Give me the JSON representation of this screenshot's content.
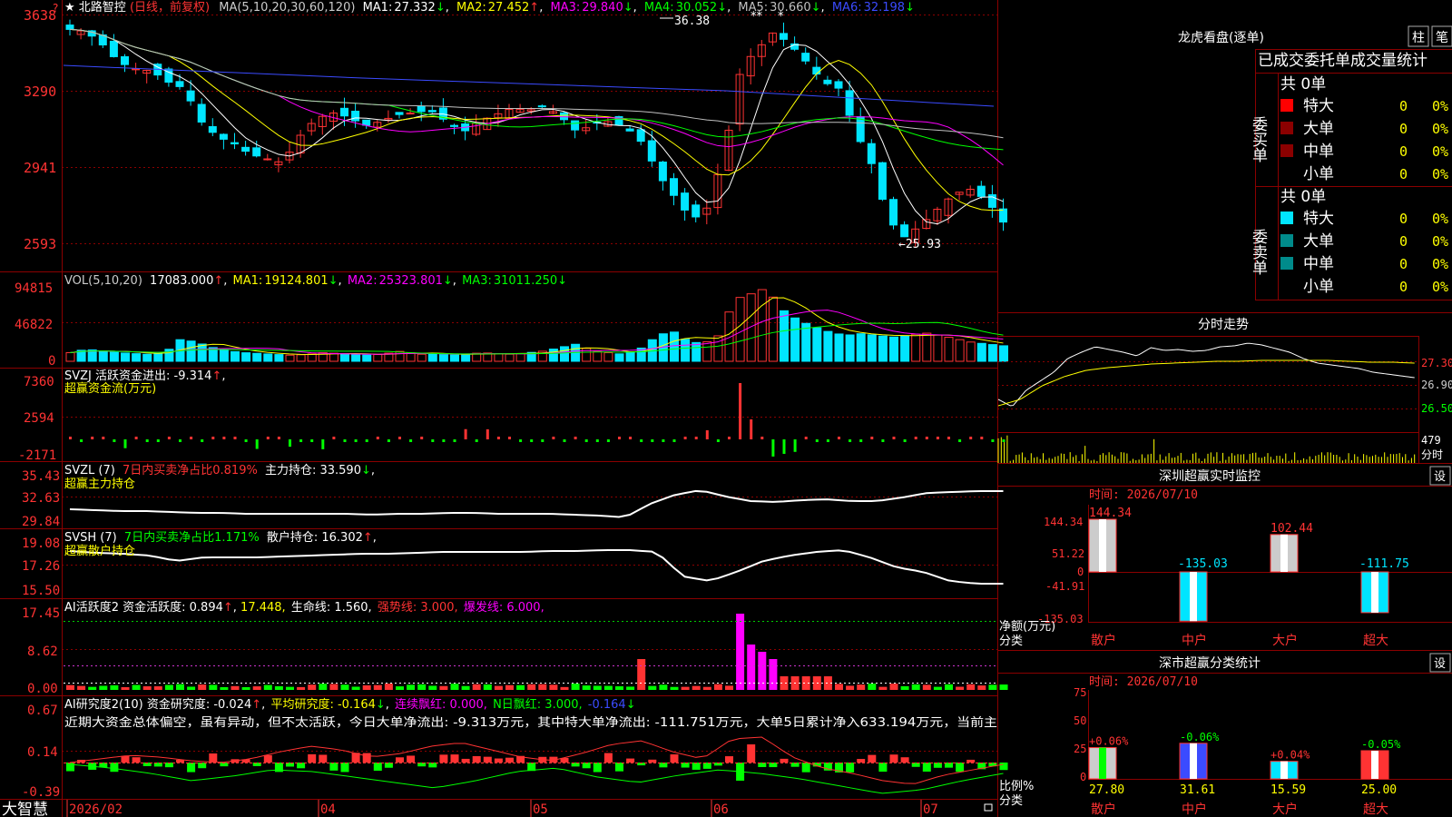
{
  "app": {
    "logo": "大智慧",
    "star": "★",
    "name": "北路智控",
    "period": "(日线，前复权)"
  },
  "colors": {
    "up": "#ff3333",
    "down": "#00e5ff",
    "grid": "#8b0000",
    "ma1": "#ffffff",
    "ma2": "#ffff00",
    "ma3": "#ff00ff",
    "ma4": "#00ff00",
    "ma5": "#c0c0c0",
    "ma6": "#3b4bff"
  },
  "icons": [
    "question-icon",
    "star-icon",
    "settings-icon",
    "lock-icon"
  ],
  "main": {
    "ma_prefix": "MA(5,10,20,30,60,120)",
    "ma": [
      {
        "label": "MA1:",
        "value": "27.332",
        "arrow": "↓"
      },
      {
        "label": "MA2:",
        "value": "27.452",
        "arrow": "↑"
      },
      {
        "label": "MA3:",
        "value": "29.840",
        "arrow": "↓"
      },
      {
        "label": "MA4:",
        "value": "30.052",
        "arrow": "↓"
      },
      {
        "label": "MA5:",
        "value": "30.660",
        "arrow": "↓"
      },
      {
        "label": "MA6:",
        "value": "32.198",
        "arrow": "↓"
      }
    ],
    "y_ticks": [
      "3638",
      "3290",
      "2941",
      "2593"
    ],
    "hi_label": "36.38",
    "lo_label": "←25.93",
    "markers": [
      "**",
      "*"
    ]
  },
  "vol": {
    "prefix": "VOL(5,10,20)",
    "value": "17083.000",
    "arrow": "↑",
    "ma": [
      {
        "label": "MA1:",
        "value": "19124.801",
        "arrow": "↓"
      },
      {
        "label": "MA2:",
        "value": "25323.801",
        "arrow": "↓"
      },
      {
        "label": "MA3:",
        "value": "31011.250",
        "arrow": "↓"
      }
    ],
    "y_ticks": [
      "94815",
      "46822",
      "0"
    ]
  },
  "svzj": {
    "line1": "SVZJ  活跃资金进出: -9.314",
    "arrow": "↑",
    "line2": "超赢资金流(万元)",
    "y_ticks": [
      "7360",
      "2594",
      "-2171"
    ]
  },
  "svzl": {
    "name": "SVZL (7)",
    "l1": "7日内买卖净占比0.819%",
    "l2": "主力持仓: 33.590",
    "arrow": "↓",
    "line2": "超赢主力持仓",
    "y_ticks": [
      "35.43",
      "32.63",
      "29.84"
    ]
  },
  "svsh": {
    "name": "SVSH (7)",
    "l1": "7日内买卖净占比1.171%",
    "l2": "散户持仓: 16.302",
    "arrow": "↑",
    "line2": "超赢散户持仓",
    "y_ticks": [
      "19.08",
      "17.26",
      "15.50"
    ]
  },
  "ai1": {
    "a": "AI活跃度2 资金活跃度: 0.894",
    "b": "17.448,",
    "c": "生命线: 1.560,",
    "d": "强势线: 3.000,",
    "e": "爆发线: 6.000,",
    "y_ticks": [
      "17.45",
      "8.62",
      "0.00"
    ]
  },
  "ai2": {
    "a": "AI研究度2(10) 资金研究度: -0.024",
    "b": "平均研究度: -0.164",
    "c": "连续飘红: 0.000,",
    "d": "N日飘红: 3.000,",
    "e": "-0.164",
    "comment": "近期大资金总体偏空，虽有异动，但不太活跃，今日大单净流出: -9.313万元，其中特大单净流出: -111.751万元，大单5日累计净入633.194万元，当前主",
    "y_ticks": [
      "0.67",
      "0.14",
      "-0.39"
    ]
  },
  "xaxis": [
    "2026/02",
    "04",
    "05",
    "06",
    "07"
  ],
  "lhb": {
    "title": "龙虎看盘(逐单)",
    "btn1": "柱",
    "btn2": "笔",
    "tabs": [
      "已成交",
      "委托单",
      "成交量统计"
    ],
    "buy_label": "委买单",
    "sell_label": "委卖单",
    "total": "共 0单",
    "buy_rows": [
      {
        "name": "特大",
        "v": "0",
        "p": "0%"
      },
      {
        "name": "大单",
        "v": "0",
        "p": "0%"
      },
      {
        "name": "中单",
        "v": "0",
        "p": "0%"
      },
      {
        "name": "小单",
        "v": "0",
        "p": "0%"
      }
    ],
    "sell_rows": [
      {
        "name": "特大",
        "v": "0",
        "p": "0%"
      },
      {
        "name": "大单",
        "v": "0",
        "p": "0%"
      },
      {
        "name": "中单",
        "v": "0",
        "p": "0%"
      },
      {
        "name": "小单",
        "v": "0",
        "p": "0%"
      }
    ]
  },
  "intraday": {
    "title": "分时走势",
    "y_ticks": [
      "27.30",
      "26.90",
      "26.50"
    ],
    "vol_tick": "479",
    "vol_label": "分时"
  },
  "monitor": {
    "title": "深圳超赢实时监控",
    "set": "设",
    "time": "时间: 2026/07/10",
    "y_ticks": [
      "144.34",
      "51.22",
      "0",
      "-41.91",
      "-135.03"
    ],
    "bars": [
      {
        "v": "144.34"
      },
      {
        "v": "-135.03"
      },
      {
        "v": "102.44"
      },
      {
        "v": "-111.75"
      }
    ],
    "cats": [
      "散户",
      "中户",
      "大户",
      "超大"
    ],
    "ylabel1": "净额(万元)",
    "ylabel2": "分类"
  },
  "classify": {
    "title": "深市超赢分类统计",
    "set": "设",
    "time": "时间: 2026/07/10",
    "y_ticks": [
      "75",
      "50",
      "25",
      "0"
    ],
    "bars": [
      {
        "v": "27.80",
        "d": "+0.06%"
      },
      {
        "v": "31.61",
        "d": "-0.06%"
      },
      {
        "v": "15.59",
        "d": "+0.04%"
      },
      {
        "v": "25.00",
        "d": "-0.05%"
      }
    ],
    "cats": [
      "散户",
      "中户",
      "大户",
      "超大"
    ],
    "ylabel1": "比例%",
    "ylabel2": "分类"
  }
}
